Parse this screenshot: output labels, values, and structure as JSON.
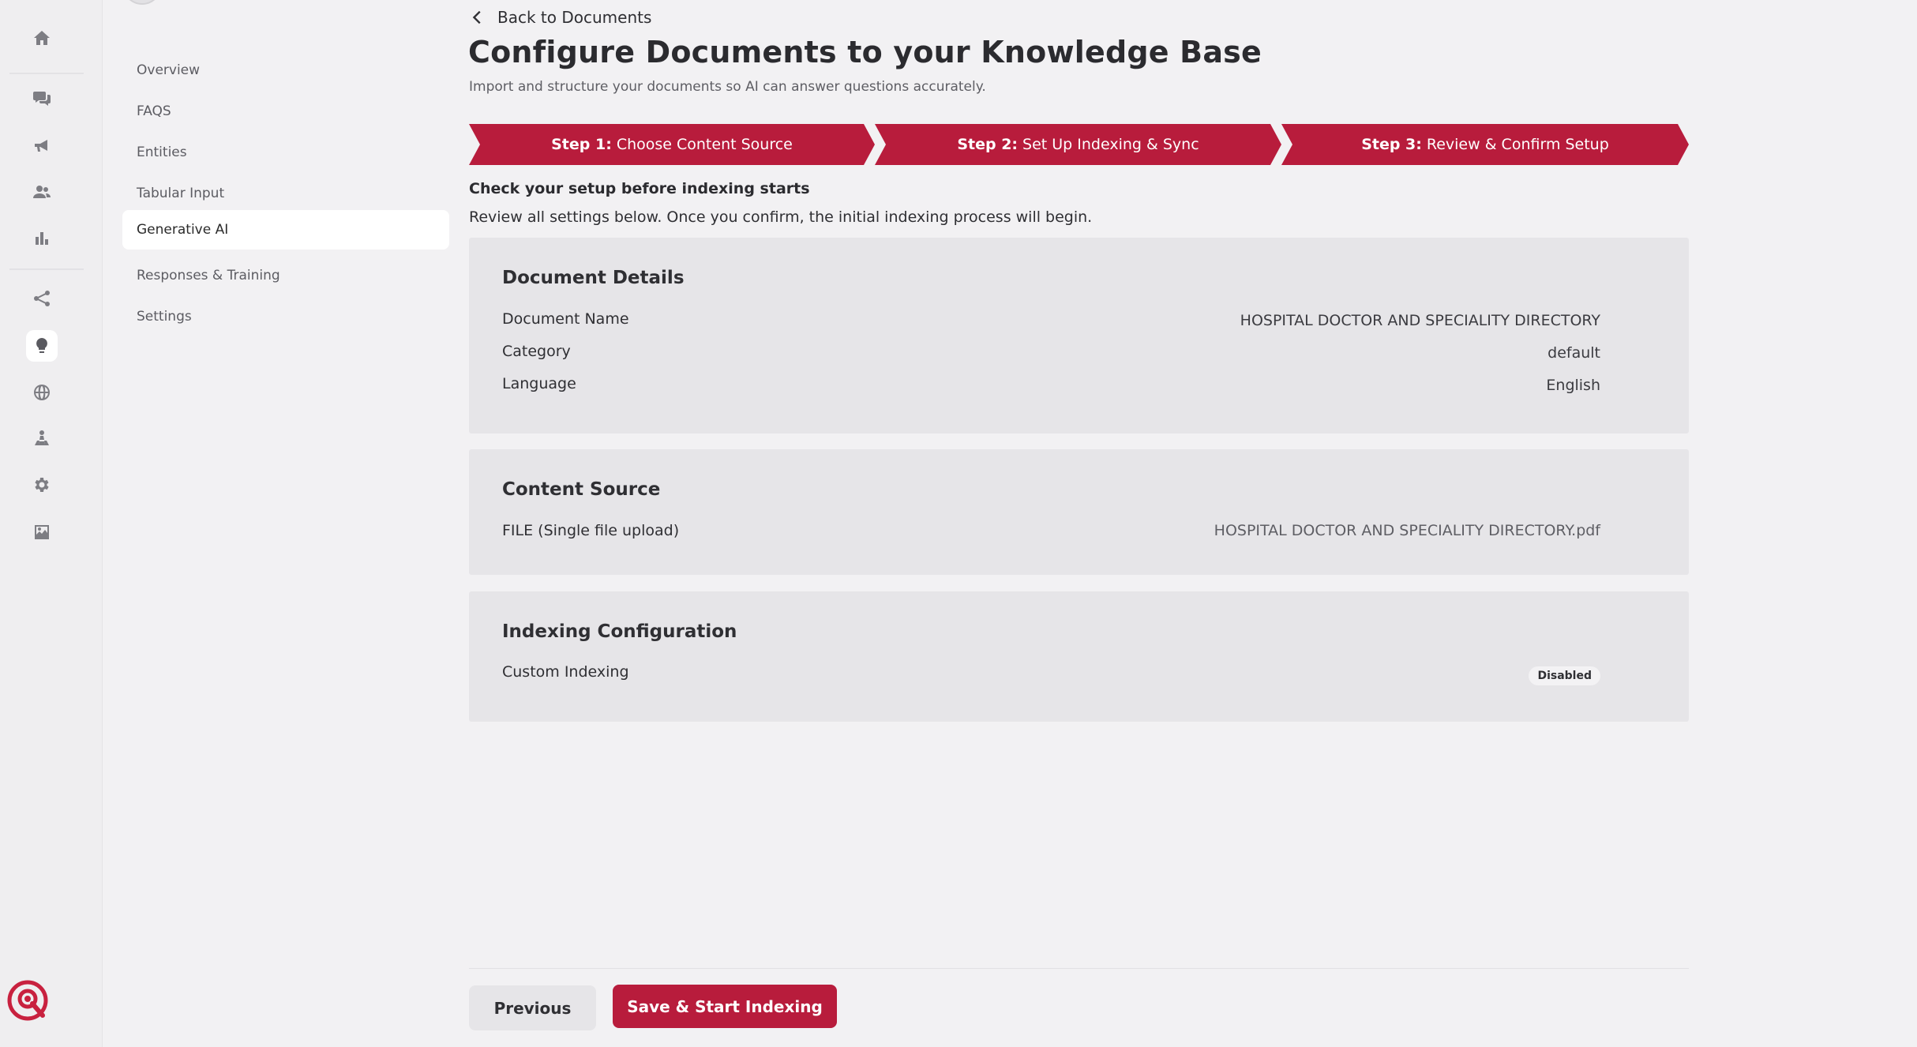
{
  "colors": {
    "accent": "#b81c3c",
    "background": "#f2f1f3",
    "card": "#e6e5e8"
  },
  "rail": {
    "icons": [
      "home-icon",
      "chat-icon",
      "megaphone-icon",
      "users-icon",
      "bar-chart-icon",
      "share-icon",
      "lightbulb-icon",
      "globe-icon",
      "hierarchy-icon",
      "gear-icon",
      "image-icon"
    ],
    "active": "lightbulb-icon"
  },
  "subnav": {
    "items": [
      {
        "label": "Overview"
      },
      {
        "label": "FAQS"
      },
      {
        "label": "Entities"
      },
      {
        "label": "Tabular Input"
      },
      {
        "label": "Generative AI"
      },
      {
        "label": "Responses & Training"
      },
      {
        "label": "Settings"
      }
    ],
    "active": "Generative AI"
  },
  "header": {
    "back_label": "Back to Documents",
    "title": "Configure Documents to your Knowledge Base",
    "subtitle": "Import and structure your documents so AI can answer questions accurately."
  },
  "stepper": {
    "steps": [
      {
        "prefix": "Step 1:",
        "label": "Choose Content Source"
      },
      {
        "prefix": "Step 2:",
        "label": "Set Up Indexing & Sync"
      },
      {
        "prefix": "Step 3:",
        "label": "Review & Confirm Setup"
      }
    ]
  },
  "review": {
    "title": "Check your setup before indexing starts",
    "description": "Review all settings below. Once you confirm, the initial indexing process will begin."
  },
  "document_details": {
    "title": "Document Details",
    "rows": [
      {
        "label": "Document Name",
        "value": "HOSPITAL DOCTOR AND SPECIALITY DIRECTORY"
      },
      {
        "label": "Category",
        "value": "default"
      },
      {
        "label": "Language",
        "value": "English"
      }
    ]
  },
  "content_source": {
    "title": "Content Source",
    "label": "FILE (Single file upload)",
    "value": "HOSPITAL DOCTOR AND SPECIALITY DIRECTORY.pdf"
  },
  "indexing": {
    "title": "Indexing Configuration",
    "label": "Custom Indexing",
    "status": "Disabled"
  },
  "footer": {
    "previous_label": "Previous",
    "primary_label": "Save & Start Indexing"
  }
}
